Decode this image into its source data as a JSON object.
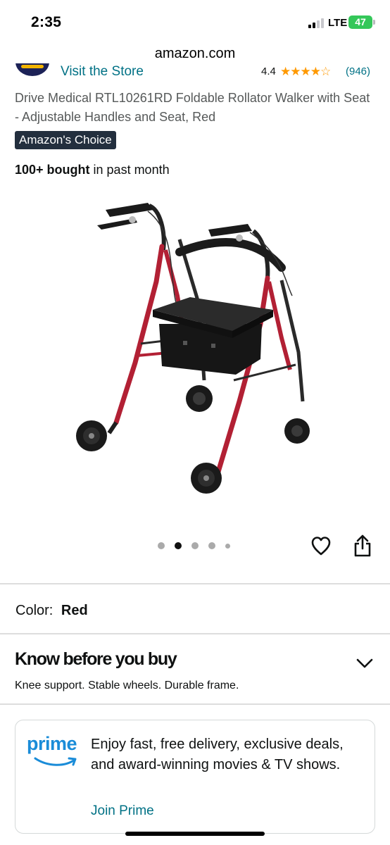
{
  "status_bar": {
    "time": "2:35",
    "network": "LTE",
    "battery": "47",
    "battery_color": "#34c759"
  },
  "browser": {
    "url": "amazon.com"
  },
  "store": {
    "link_label": "Visit the Store",
    "rating": "4.4",
    "stars": "★★★★☆",
    "stars_value": 4.4,
    "rating_count": "(946)"
  },
  "product": {
    "title": "Drive Medical RTL10261RD Foldable Rollator Walker with Seat - Adjustable Handles and Seat, Red",
    "badge": "Amazon's Choice",
    "bought_bold": "100+ bought",
    "bought_rest": "in past month",
    "image_icon": "rollator-walker-image",
    "carousel": {
      "total_dots": 5,
      "active_index": 1
    }
  },
  "actions": {
    "favorite_icon": "heart-icon",
    "share_icon": "share-icon"
  },
  "color": {
    "label": "Color:",
    "value": "Red"
  },
  "know_before": {
    "title": "Know before you buy",
    "text": "Knee support. Stable wheels. Durable frame."
  },
  "prime": {
    "logo": "prime",
    "text": "Enjoy fast, free delivery, exclusive deals, and award-winning movies & TV shows.",
    "link": "Join Prime",
    "brand_color": "#1a8cd8"
  },
  "colors": {
    "link": "#007185",
    "star": "#ff9900",
    "badge_bg": "#232f3e",
    "frame_red": "#b22034"
  }
}
